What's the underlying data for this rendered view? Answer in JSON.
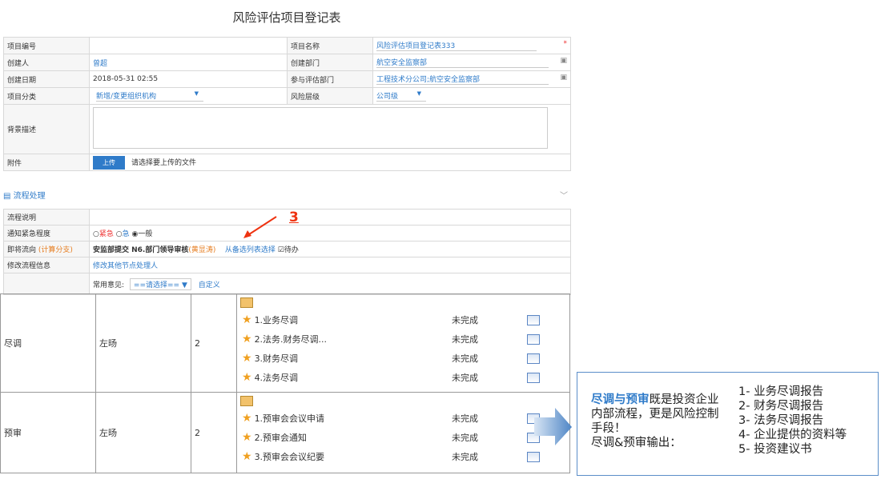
{
  "page_title": "风险评估项目登记表",
  "form": {
    "project_no_label": "项目编号",
    "project_no_value": "",
    "project_name_label": "项目名称",
    "project_name_value": "风险评估项目登记表333",
    "creator_label": "创建人",
    "creator_value": "曾超",
    "create_dept_label": "创建部门",
    "create_dept_value": "航空安全监察部",
    "create_date_label": "创建日期",
    "create_date_value": "2018-05-31 02:55",
    "eval_dept_label": "参与评估部门",
    "eval_dept_value": "工程技术分公司;航空安全监察部",
    "category_label": "项目分类",
    "category_value": "新增/变更组织机构",
    "risk_level_label": "风险层级",
    "risk_level_value": "公司级",
    "background_label": "背景描述",
    "attachment_label": "附件",
    "upload_button": "上传",
    "upload_hint": "请选择要上传的文件",
    "required_mark": "*"
  },
  "section": {
    "title": "流程处理"
  },
  "flow": {
    "desc_label": "流程说明",
    "urgency_label": "通知紧急程度",
    "urgency_options": [
      "紧急",
      "急",
      "一般"
    ],
    "next_label": "即将流向",
    "next_label_sub": "(计算分支)",
    "next_value": "安监部提交 N6.部门领导审核",
    "next_person": "(黄显涛)",
    "choose_link": "从备选列表选择",
    "pending": "待办",
    "modify_label": "修改流程信息",
    "modify_link": "修改其他节点处理人",
    "common_opinion_label": "常用意见:",
    "common_opinion_select": "==请选择==",
    "custom_link": "自定义"
  },
  "annotation_number": "3",
  "grid": {
    "rows": [
      {
        "name": "尽调",
        "col2": "左旸",
        "col3": "2",
        "tasks": [
          {
            "label": "1.业务尽调",
            "status": "未完成"
          },
          {
            "label": "2.法务.财务尽调...",
            "status": "未完成"
          },
          {
            "label": "3.财务尽调",
            "status": "未完成"
          },
          {
            "label": "4.法务尽调",
            "status": "未完成"
          }
        ]
      },
      {
        "name": "预审",
        "col2": "左旸",
        "col3": "2",
        "tasks": [
          {
            "label": "1.预审会会议申请",
            "status": "未完成"
          },
          {
            "label": "2.预审会通知",
            "status": "未完成"
          },
          {
            "label": "3.预审会会议纪要",
            "status": "未完成"
          }
        ]
      }
    ]
  },
  "callout": {
    "highlight": "尽调与预审",
    "text1": "既是投资企业内部流程，更是风险控制手段！",
    "text2": "尽调&预审输出：",
    "list": [
      "1- 业务尽调报告",
      "2- 财务尽调报告",
      "3- 法务尽调报告",
      "4- 企业提供的资料等",
      "5- 投资建议书"
    ]
  },
  "colors": {
    "accent": "#2f7bc9",
    "required": "#e33",
    "star": "#f0a020"
  }
}
